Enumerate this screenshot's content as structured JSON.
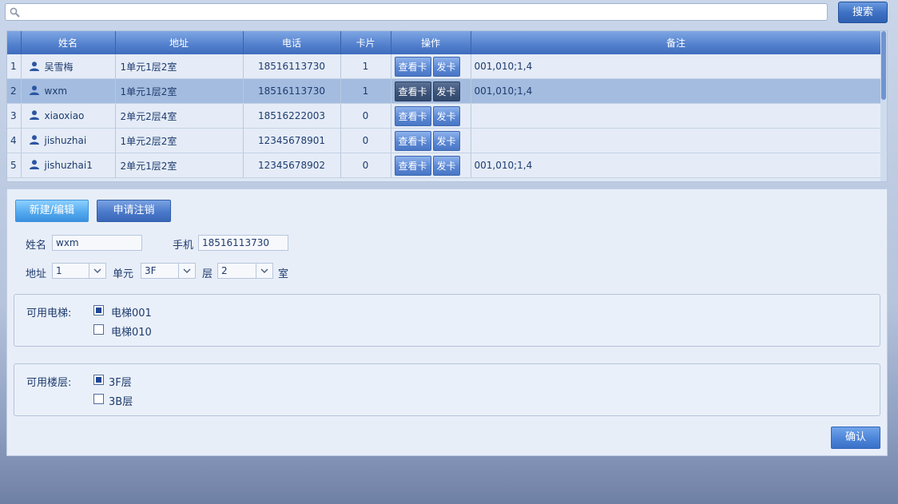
{
  "search": {
    "placeholder": "",
    "button_label": "搜索"
  },
  "table": {
    "columns": [
      "",
      "姓名",
      "地址",
      "电话",
      "卡片",
      "操作",
      "备注"
    ],
    "view_card_label": "查看卡",
    "issue_card_label": "发卡",
    "selected_row": 1,
    "rows": [
      {
        "index": "1",
        "name": "吴雪梅",
        "address": "1单元1层2室",
        "phone": "18516113730",
        "cards": "1",
        "note": "001,010;1,4"
      },
      {
        "index": "2",
        "name": "wxm",
        "address": "1单元1层2室",
        "phone": "18516113730",
        "cards": "1",
        "note": "001,010;1,4"
      },
      {
        "index": "3",
        "name": "xiaoxiao",
        "address": "2单元2层4室",
        "phone": "18516222003",
        "cards": "0",
        "note": ""
      },
      {
        "index": "4",
        "name": "jishuzhai",
        "address": "1单元2层2室",
        "phone": "12345678901",
        "cards": "0",
        "note": ""
      },
      {
        "index": "5",
        "name": "jishuzhai1",
        "address": "2单元1层2室",
        "phone": "12345678902",
        "cards": "0",
        "note": "001,010;1,4"
      }
    ]
  },
  "form": {
    "tab_new_edit": "新建/编辑",
    "tab_apply_cancel": "申请注销",
    "name_label": "姓名",
    "name_value": "wxm",
    "mobile_label": "手机",
    "mobile_value": "18516113730",
    "address_label": "地址",
    "unit_value": "1",
    "unit_suffix": "单元",
    "floor_value": "3F",
    "floor_suffix": "层",
    "room_value": "2",
    "room_suffix": "室",
    "elevators_label": "可用电梯:",
    "elevators": [
      {
        "label": "电梯001",
        "checked": true
      },
      {
        "label": "电梯010",
        "checked": false
      }
    ],
    "floors_label": "可用楼层:",
    "floors": [
      {
        "label": "3F层",
        "checked": true
      },
      {
        "label": "3B层",
        "checked": false
      }
    ],
    "confirm_label": "确认"
  },
  "colors": {
    "header_blue": "#5683cf",
    "selected_row": "#a3bcdf",
    "checkbox_fill": "#1f4595"
  }
}
